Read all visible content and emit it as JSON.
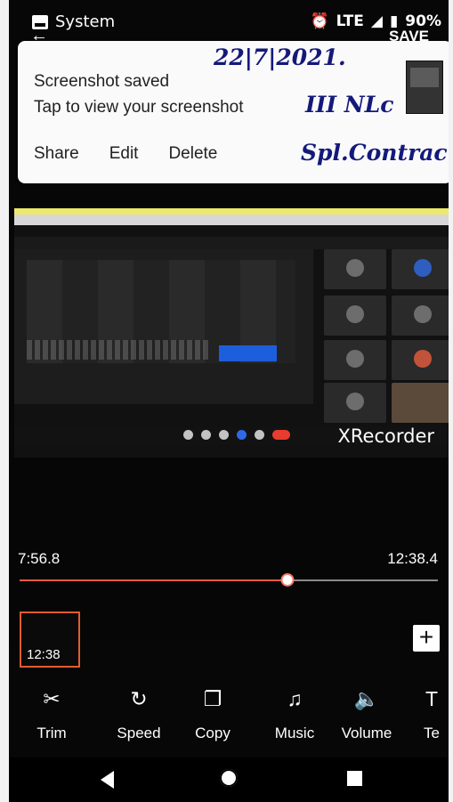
{
  "status": {
    "title": "System",
    "network": "LTE",
    "battery": "90%"
  },
  "header": {
    "save_label": "SAVE"
  },
  "notification": {
    "title": "Screenshot saved",
    "subtitle": "Tap to view your screenshot",
    "actions": [
      "Share",
      "Edit",
      "Delete"
    ],
    "handwriting": {
      "date": "22|7|2021.",
      "line2": "III NLc",
      "line3": "Spl.Contract"
    }
  },
  "recording": {
    "watermark": "XRecorder"
  },
  "timeline": {
    "start_time": "7:56.8",
    "end_time": "12:38.4",
    "progress_fraction": 0.64
  },
  "clip": {
    "duration": "12:38"
  },
  "tools": [
    {
      "icon": "scissors-icon",
      "label": "Trim"
    },
    {
      "icon": "speed-icon",
      "label": "Speed"
    },
    {
      "icon": "copy-icon",
      "label": "Copy"
    },
    {
      "icon": "music-note-icon",
      "label": "Music"
    },
    {
      "icon": "volume-icon",
      "label": "Volume"
    },
    {
      "icon": "text-icon",
      "label": "Te"
    }
  ],
  "colors": {
    "accent": "#ea5b46",
    "background": "#070707"
  }
}
